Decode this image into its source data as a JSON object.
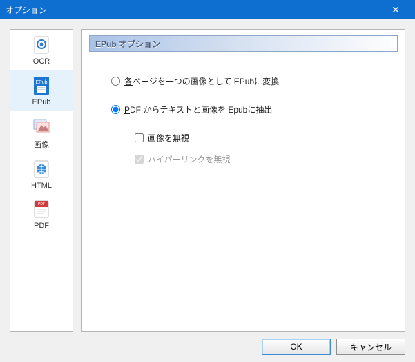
{
  "window": {
    "title": "オプション",
    "close_glyph": "✕"
  },
  "sidebar": {
    "items": [
      {
        "id": "ocr",
        "label": "OCR"
      },
      {
        "id": "epub",
        "label": "EPub"
      },
      {
        "id": "image",
        "label": "画像"
      },
      {
        "id": "html",
        "label": "HTML"
      },
      {
        "id": "pdf",
        "label": "PDF"
      }
    ],
    "selected_id": "epub"
  },
  "panel": {
    "header": "EPub オプション",
    "radio_each_page": {
      "underline": "各",
      "rest": "ページを一つの画像として EPubに変換"
    },
    "radio_extract": {
      "underline": "P",
      "rest": "DF からテキストと画像を Epubに抽出"
    },
    "selected_radio": "extract",
    "check_ignore_images": {
      "label": "画像を無視",
      "checked": false,
      "disabled": false
    },
    "check_ignore_links": {
      "label": "ハイパーリンクを無視",
      "checked": true,
      "disabled": true
    }
  },
  "footer": {
    "ok": "OK",
    "cancel": "キャンセル"
  }
}
